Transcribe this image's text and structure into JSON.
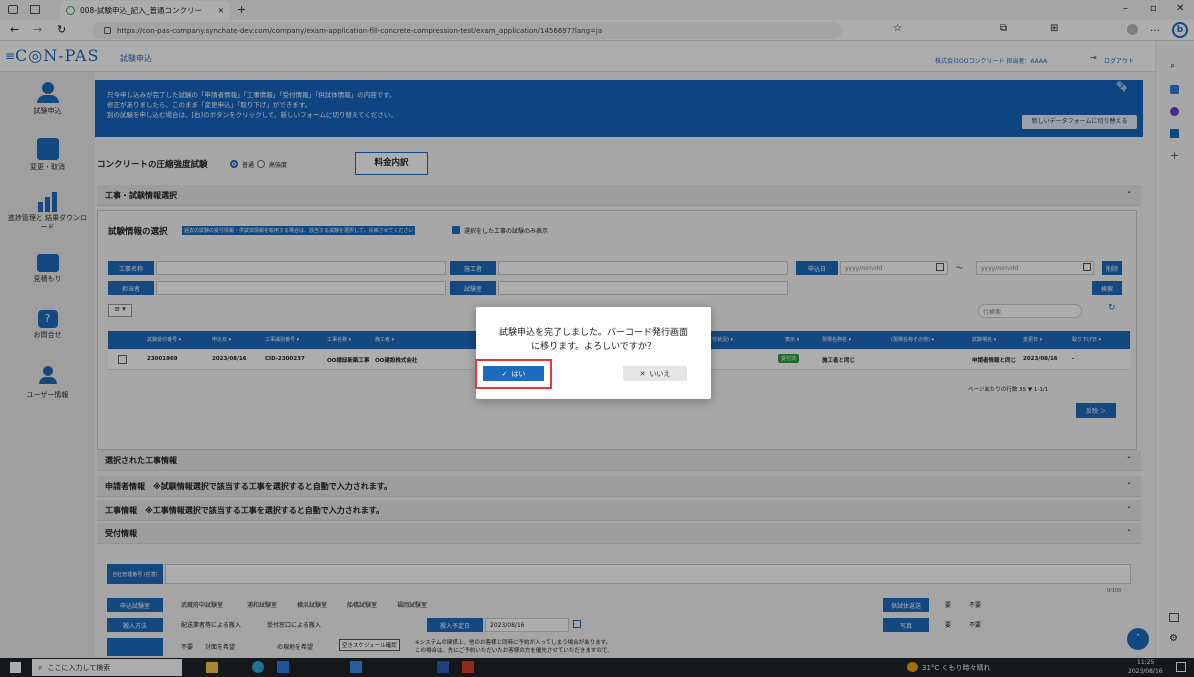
{
  "browser": {
    "tab_title": "008-試験申込_記入_普通コンクリー",
    "url": "https://con-pas-company.synchate-dev.com/company/exam-application-fill-concrete-compression-test/exam_application/1456697?lang=ja"
  },
  "app": {
    "logo": "C◎N-PAS",
    "page_name": "試験申込",
    "user_info": "株式会社OOコンクリート 担当者：AAAA",
    "logout": "ログアウト"
  },
  "sidebar": {
    "items": [
      {
        "label": "試験申込"
      },
      {
        "label": "変更・取消"
      },
      {
        "label": "進捗管理と 結果ダウンロード"
      },
      {
        "label": "見積もり"
      },
      {
        "label": "お問合せ"
      },
      {
        "label": "ユーザー情報"
      }
    ]
  },
  "notice": {
    "lines": [
      "只今申し込みが完了した試験の「申請者情報」「工事情報」「受付情報」「供試体情報」の内容です。",
      "修正がありましたら、このまま「変更申込」「取り下げ」ができます。",
      "別の試験を申し込む場合は、[右]のボタンをクリックして、新しいフォームに切り替えてください。"
    ],
    "switch_button": "新しいデータフォームに切り替える",
    "corner_badge": "編集"
  },
  "test": {
    "title": "コンクリートの圧縮強度試験",
    "options": [
      "普通",
      "高強度"
    ],
    "fee_button": "料金内訳"
  },
  "sections": {
    "construction_selection": "工事・試験情報選択",
    "test_info_selection": "試験情報の選択",
    "selection_note": "過去の試験の受付情報・供試体情報を転用する場合は、該当する試験を選択して、反映させてください",
    "only_selected": "選択をした工事の試験のみ表示",
    "selected_construction": "選択された工事情報",
    "applicant": "申請者情報　※試験情報選択で該当する工事を選択すると自動で入力されます。",
    "construction": "工事情報　※工事情報選択で該当する工事を選択すると自動で入力されます。",
    "reception": "受付情報"
  },
  "filters": {
    "construction_name": "工事名称",
    "contractor": "施工者",
    "apply_date": "申込日",
    "date_placeholder": "yyyy/mm/dd",
    "tilde": "～",
    "clear": "削除",
    "person": "担当者",
    "lab": "試験室",
    "search": "検索"
  },
  "table": {
    "headers": [
      "試験受付番号",
      "申込日",
      "工事識別番号",
      "工事名称",
      "施工者",
      "工事(受付状況)",
      "表示",
      "現場名称名",
      "(現場名称その他)",
      "試験場名",
      "変更日",
      "取り下げ日"
    ],
    "row": {
      "id": "23001969",
      "date": "2023/08/16",
      "code": "CID-2300237",
      "name": "OO様邸新築工事",
      "contractor": "OO建設株式会社",
      "status": "受付済",
      "site": "施工者と同じ",
      "lab": "申請者情報と同じ",
      "changed": "2023/08/16",
      "withdrawn": "-"
    },
    "search_placeholder": "行検索",
    "pager": "ページあたりの行数 35 ▼ 1-1/1",
    "next": "反映 ＞"
  },
  "reception": {
    "own_number_label": "自社管理番号 (任意)",
    "counter": "0/100",
    "apply_lab_label": "申込試験室",
    "labs": [
      "武蔵府中試験室",
      "浦和試験室",
      "横浜試験室",
      "船橋試験室",
      "福岡試験室"
    ],
    "delivery_label": "搬入方法",
    "delivery_options": [
      "配送業者等による搬入",
      "受付窓口による搬入"
    ],
    "delivery_date_label": "搬入予定日",
    "delivery_date": "2023/08/16",
    "specimen_return_label": "供試体返送",
    "photo_label": "写真",
    "yes": "要",
    "no": "不要",
    "request_label": "不要",
    "request_opt": "対面を希望",
    "site_hope": "の現地を希望",
    "schedule_btn": "空きスケジュール確認",
    "note1": "※システムの関係上、他のお客様と同時に予約が入ってしまう場合があります。",
    "note2": "この場合は、先にご予約いただいたお客様の方を優先させていただきますので、"
  },
  "dialog": {
    "message_line1": "試験申込を完了しました。バーコード発行画面",
    "message_line2": "に移ります。よろしいですか？",
    "yes": "はい",
    "no": "いいえ"
  },
  "taskbar": {
    "search_placeholder": "ここに入力して検索",
    "weather": "31°C くもり時々晴れ",
    "time": "11:25",
    "date": "2023/08/16"
  },
  "colors": {
    "accent": "#1e6bbd",
    "highlight": "#e53935"
  }
}
